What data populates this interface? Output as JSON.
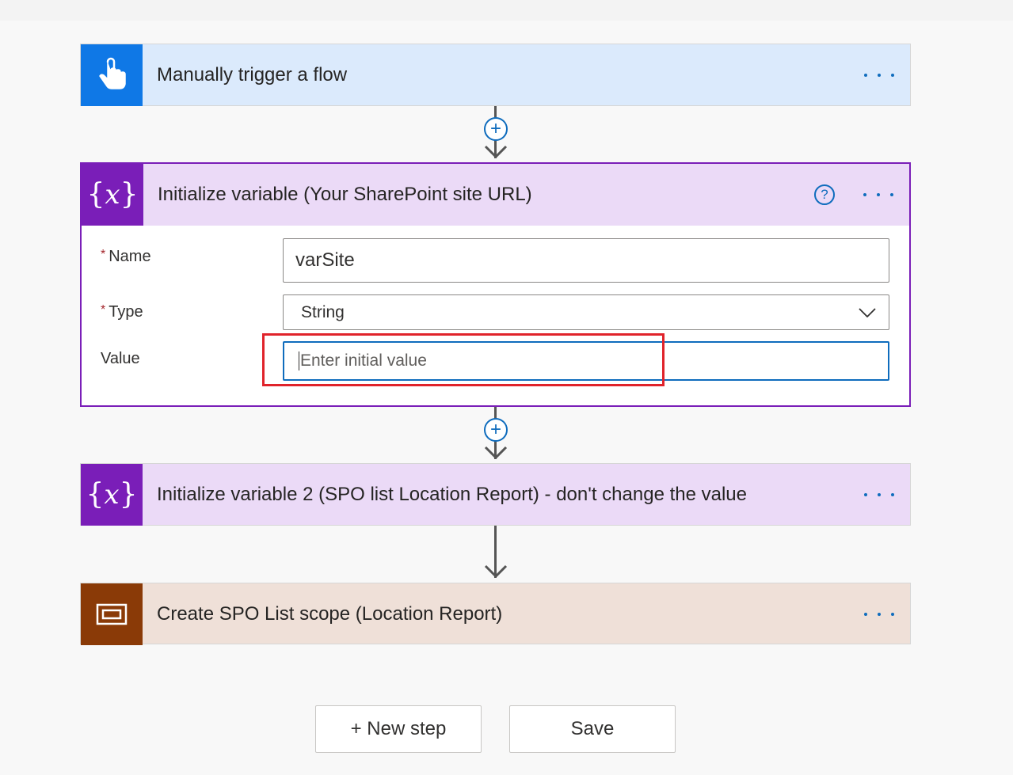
{
  "flow": {
    "trigger": {
      "title": "Manually trigger a flow",
      "icon": "hand-touch-icon"
    },
    "init_variable_1": {
      "title": "Initialize variable (Your SharePoint site URL)",
      "icon": "variable-icon",
      "help_glyph": "?",
      "name_label": "Name",
      "name_value": "varSite",
      "type_label": "Type",
      "type_value": "String",
      "value_label": "Value",
      "value_placeholder": "Enter initial value",
      "required_marker": "*"
    },
    "init_variable_2": {
      "title": "Initialize variable 2 (SPO list Location Report) - don't change the value",
      "icon": "variable-icon"
    },
    "scope": {
      "title": "Create SPO List scope (Location Report)",
      "icon": "scope-icon"
    }
  },
  "icon_glyphs": {
    "fx_open": "{",
    "fx_var": "x",
    "fx_close": "}"
  },
  "buttons": {
    "new_step": "+ New step",
    "save": "Save"
  },
  "colors": {
    "trigger": "#0f78e6",
    "variable": "#7a1eb8",
    "scope": "#8a3a07",
    "accent": "#0f6cbd",
    "highlight": "#e0232b"
  }
}
